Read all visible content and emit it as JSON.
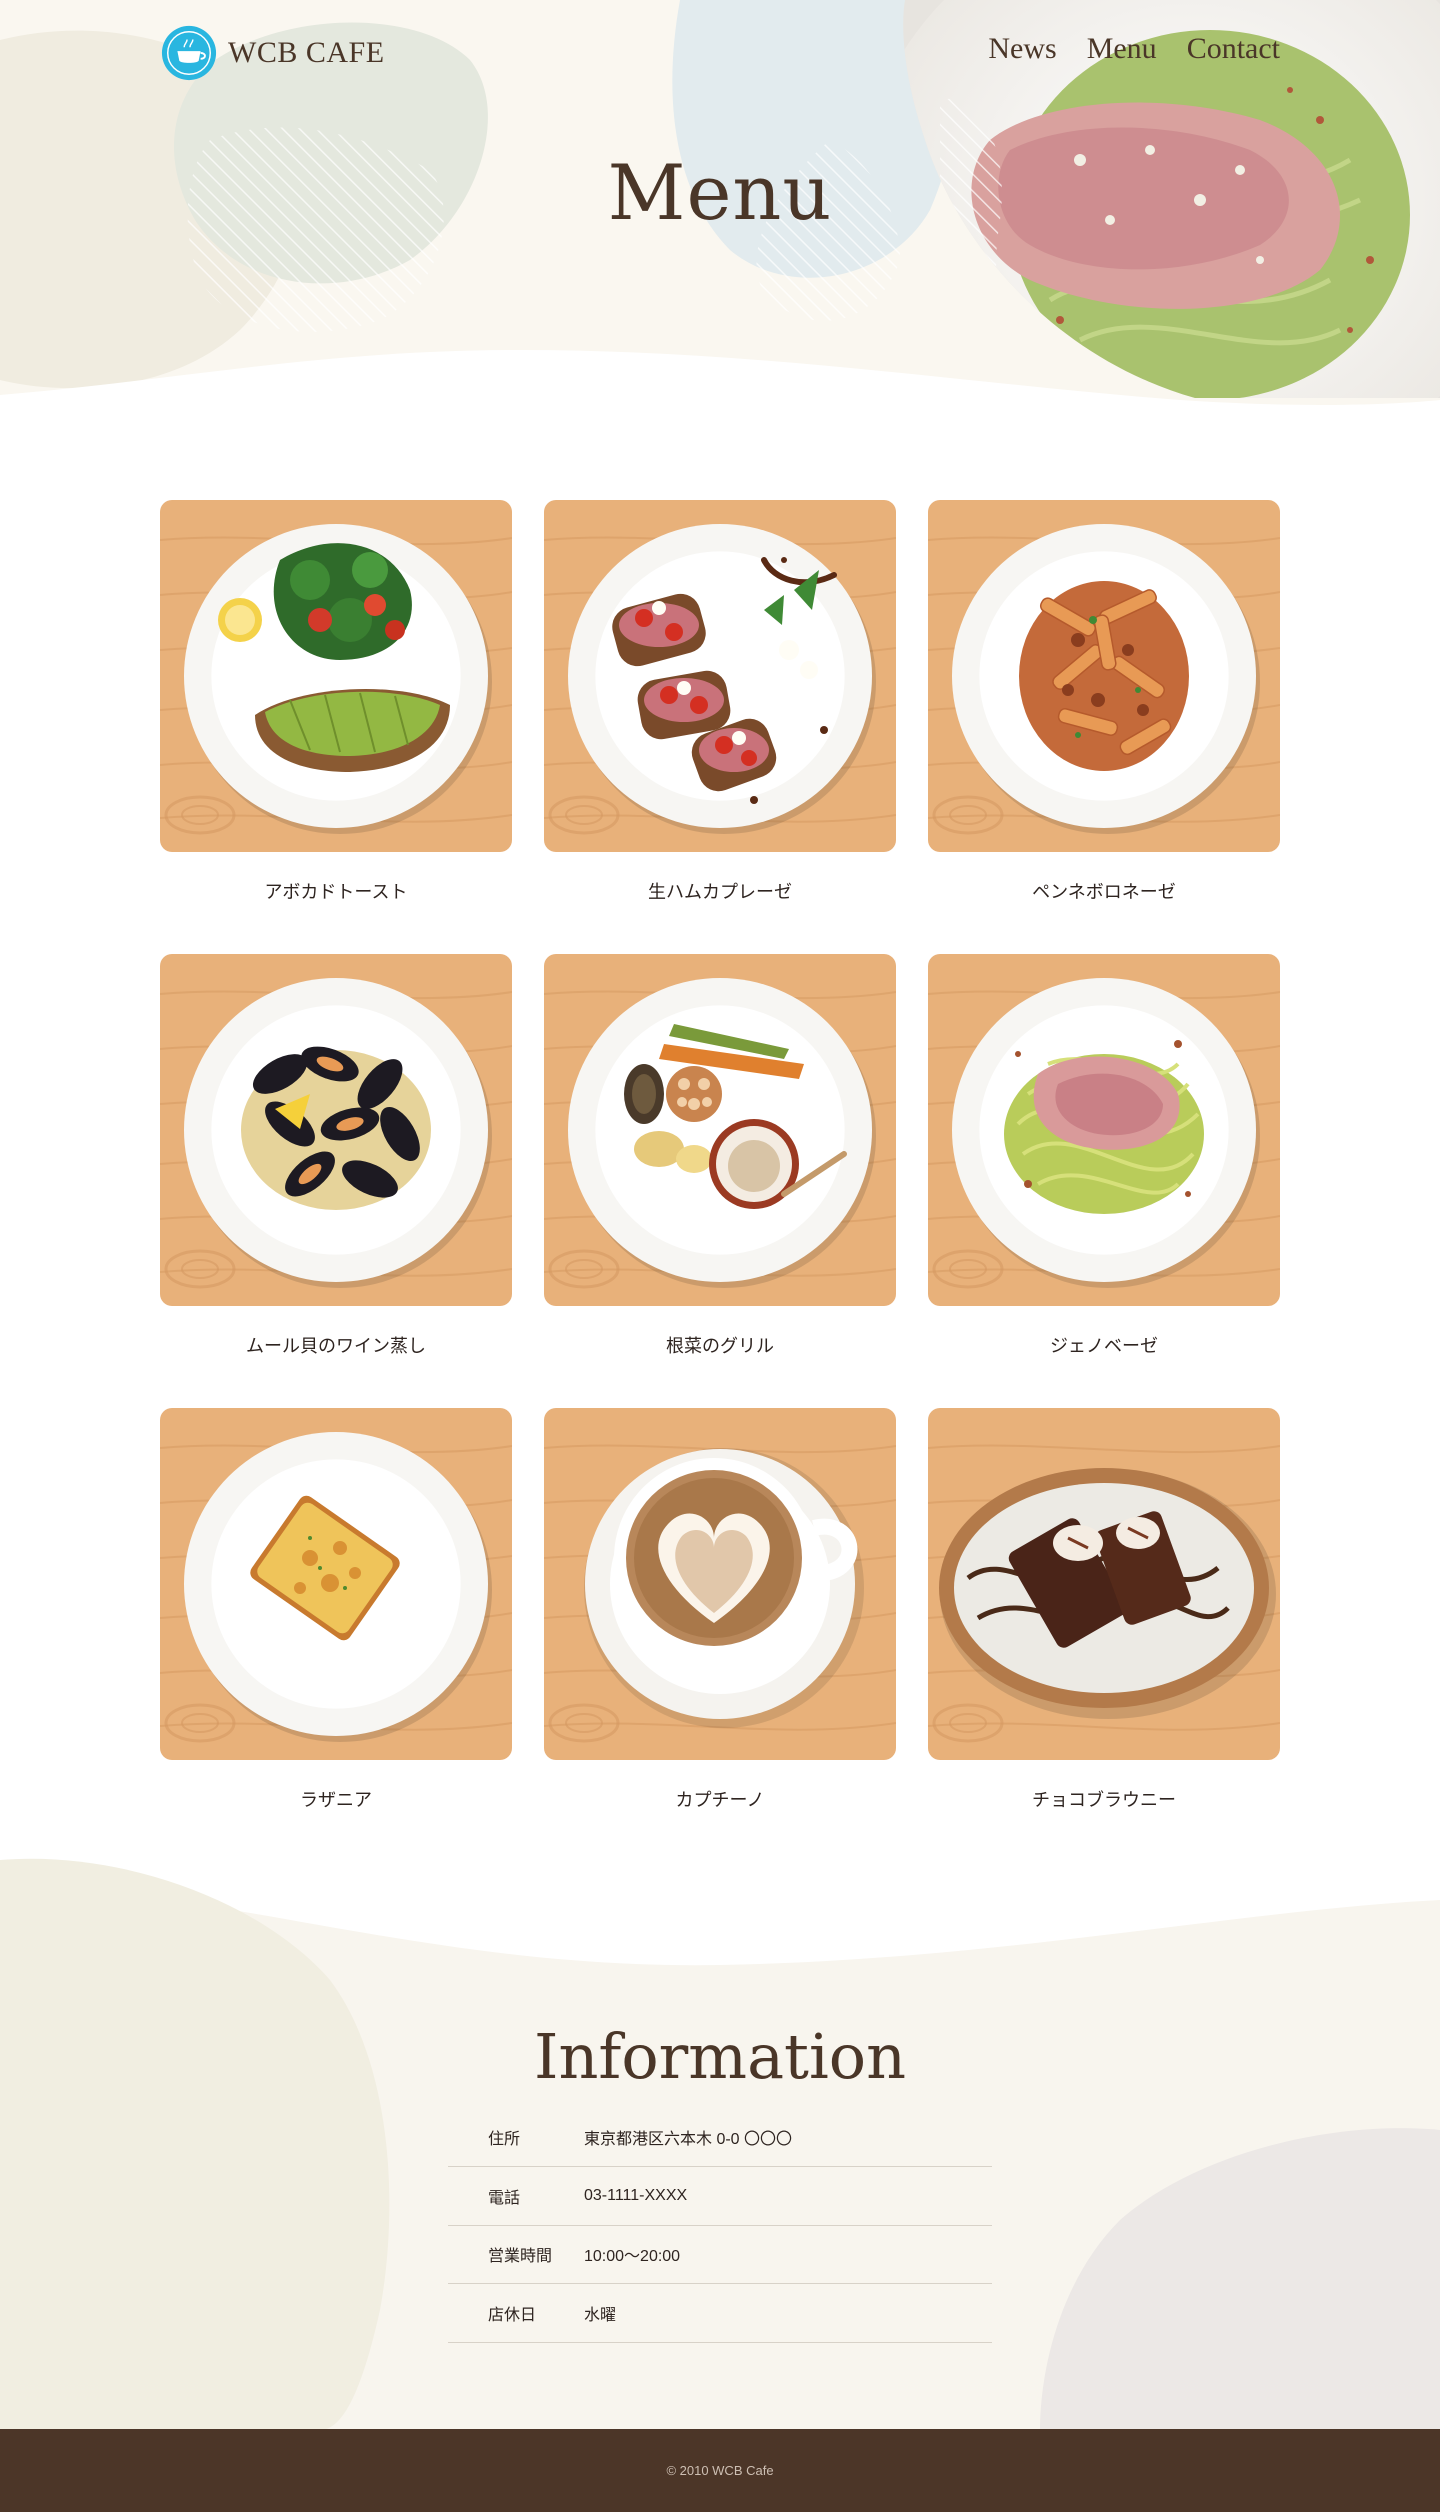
{
  "brand": {
    "name": "WCB CAFE"
  },
  "nav": [
    {
      "label": "News"
    },
    {
      "label": "Menu"
    },
    {
      "label": "Contact"
    }
  ],
  "hero": {
    "title": "Menu"
  },
  "menu": {
    "items": [
      {
        "name": "アボカドトースト",
        "photo": "avocado-toast"
      },
      {
        "name": "生ハムカプレーゼ",
        "photo": "prosciutto-caprese"
      },
      {
        "name": "ペンネボロネーゼ",
        "photo": "penne-bolognese"
      },
      {
        "name": "ムール貝のワイン蒸し",
        "photo": "steamed-mussels"
      },
      {
        "name": "根菜のグリル",
        "photo": "grilled-root-vegetables"
      },
      {
        "name": "ジェノベーゼ",
        "photo": "genovese-pasta"
      },
      {
        "name": "ラザニア",
        "photo": "lasagna"
      },
      {
        "name": "カプチーノ",
        "photo": "cappuccino"
      },
      {
        "name": "チョコブラウニー",
        "photo": "chocolate-brownie"
      }
    ]
  },
  "info": {
    "title": "Information",
    "rows": [
      {
        "label": "住所",
        "value": "東京都港区六本木 0-0 〇〇〇"
      },
      {
        "label": "電話",
        "value": "03-1111-XXXX"
      },
      {
        "label": "営業時間",
        "value": "10:00〜20:00"
      },
      {
        "label": "店休日",
        "value": "水曜"
      }
    ]
  },
  "footer": {
    "copyright": "© 2010 WCB Cafe"
  },
  "colors": {
    "brand_brown": "#4a3628",
    "footer_bg": "#4c3628",
    "cream_bg": "#f8f5ee",
    "logo_blue": "#29b6e0",
    "wood": "#e9b27c"
  }
}
